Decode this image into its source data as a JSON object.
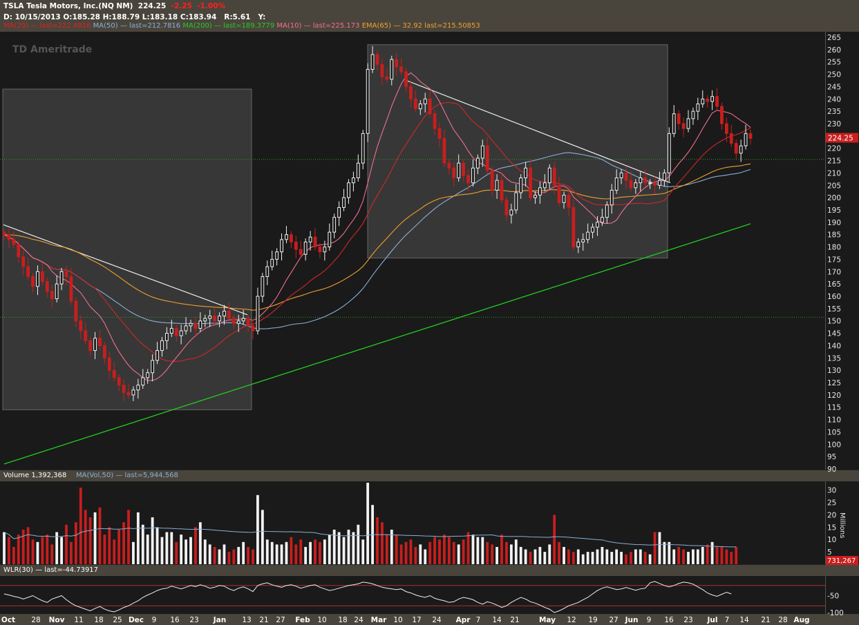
{
  "header": {
    "title": "TSLA Tesla Motors, Inc.(NQ NM)",
    "price": "224.25",
    "change": "-2.25",
    "change_pct": "-1.00%",
    "ohlc": "D: 10/15/2013  O:185.28  H:188.79  L:183.18  C:183.94",
    "r_value": "R:5.61",
    "y_label": "Y:",
    "indicators": [
      {
        "text": "MA(20) — last=222.4816",
        "color": "#e02020"
      },
      {
        "text": "MA(50) — last=212.7816",
        "color": "#8ab0d8"
      },
      {
        "text": "MA(200) — last=189.3779",
        "color": "#22cc22"
      },
      {
        "text": "MA(10) — last=225.173",
        "color": "#f07090"
      },
      {
        "text": "EMA(65) — 32.92 last=215.50853",
        "color": "#f0a030"
      }
    ]
  },
  "logo": "Ameritrade",
  "volume_strip": {
    "label": "Volume 1,392,368",
    "ma_label": "MA(Vol,50) — last=5,944,568"
  },
  "wlr_strip": {
    "label": "WLR(30) — last=-44.73917"
  },
  "price_badge": "224.25",
  "volume_badge": "731,267",
  "volume_axis_title": "Millions",
  "chart_data": [
    {
      "type": "candlestick",
      "title": "TSLA Tesla Motors, Inc.(NQ NM)",
      "ylim": [
        90,
        265
      ],
      "y_ticks": [
        90,
        95,
        100,
        105,
        110,
        115,
        120,
        125,
        130,
        135,
        140,
        145,
        150,
        155,
        160,
        165,
        170,
        175,
        180,
        185,
        190,
        195,
        200,
        205,
        210,
        215,
        220,
        225,
        230,
        235,
        240,
        245,
        250,
        255,
        260,
        265
      ],
      "x_ticks": [
        "Oct",
        "28",
        "Nov",
        "11",
        "18",
        "25",
        "Dec",
        "9",
        "16",
        "23",
        "Jan",
        "13",
        "21",
        "27",
        "Feb",
        "10",
        "18",
        "24",
        "Mar",
        "10",
        "17",
        "24",
        "Apr",
        "7",
        "14",
        "21",
        "May",
        "12",
        "19",
        "27",
        "Jun",
        "9",
        "16",
        "23",
        "Jul",
        "7",
        "14",
        "21",
        "28",
        "Aug"
      ],
      "close_series": [
        185,
        183,
        181,
        176,
        172,
        168,
        164,
        170,
        166,
        162,
        159,
        165,
        170,
        168,
        158,
        150,
        146,
        142,
        138,
        143,
        140,
        135,
        130,
        127,
        124,
        121,
        120,
        122,
        124,
        127,
        129,
        134,
        138,
        142,
        145,
        147,
        144,
        146,
        148,
        149,
        147,
        150,
        151,
        152,
        150,
        152,
        154,
        151,
        149,
        150,
        151,
        148,
        146,
        160,
        168,
        172,
        175,
        178,
        183,
        185,
        182,
        179,
        177,
        182,
        184,
        180,
        178,
        180,
        186,
        192,
        196,
        200,
        206,
        208,
        214,
        226,
        252,
        258,
        254,
        249,
        248,
        256,
        253,
        251,
        245,
        240,
        236,
        238,
        240,
        234,
        228,
        224,
        214,
        212,
        208,
        214,
        209,
        206,
        212,
        216,
        221,
        211,
        203,
        207,
        199,
        193,
        195,
        202,
        208,
        212,
        200,
        201,
        204,
        206,
        212,
        205,
        198,
        201,
        196,
        180,
        182,
        183,
        186,
        188,
        190,
        192,
        197,
        203,
        208,
        210,
        207,
        204,
        206,
        208,
        206,
        206,
        205,
        207,
        210,
        226,
        234,
        230,
        228,
        232,
        235,
        238,
        240,
        239,
        241,
        237,
        230,
        226,
        222,
        218,
        221,
        226,
        224
      ],
      "horizontal_lines": [
        151.5,
        215.5
      ]
    },
    {
      "type": "bar",
      "title": "Volume 1,392,368",
      "ylabel": "Millions",
      "ylim": [
        0,
        33
      ],
      "y_ticks": [
        5,
        10,
        15,
        20,
        25,
        30
      ],
      "values": [
        13,
        11,
        7,
        12,
        14,
        15,
        10,
        9,
        11,
        12,
        8,
        13,
        11,
        16,
        9,
        17,
        31,
        22,
        19,
        21,
        23,
        12,
        15,
        10,
        14,
        17,
        22,
        9,
        21,
        16,
        12,
        19,
        15,
        11,
        13,
        13,
        9,
        12,
        10,
        11,
        15,
        17,
        10,
        8,
        7,
        6,
        8,
        5,
        6,
        7,
        9,
        7,
        6,
        28,
        22,
        10,
        9,
        8,
        8,
        9,
        11,
        8,
        10,
        7,
        9,
        10,
        9,
        10,
        12,
        14,
        13,
        11,
        14,
        13,
        16,
        10,
        33,
        24,
        19,
        17,
        12,
        14,
        12,
        8,
        9,
        10,
        7,
        8,
        6,
        9,
        11,
        10,
        12,
        11,
        9,
        8,
        10,
        13,
        12,
        11,
        11,
        9,
        8,
        7,
        12,
        9,
        8,
        10,
        7,
        6,
        5,
        6,
        7,
        5,
        8,
        20,
        9,
        7,
        6,
        5,
        6,
        4,
        5,
        5,
        6,
        7,
        6,
        5,
        6,
        5,
        4,
        5,
        6,
        6,
        5,
        4,
        13,
        13,
        9,
        9,
        6,
        7,
        6,
        5,
        6,
        6,
        7,
        8,
        9,
        7,
        7,
        6,
        5,
        7
      ],
      "ma_label": "MA(Vol,50) — last=5,944,568"
    },
    {
      "type": "line",
      "title": "WLR(30) — last=-44.73917",
      "ylim": [
        -100,
        0
      ],
      "y_ticks": [
        -50,
        -100
      ],
      "reference_lines": [
        -20,
        -80
      ],
      "values": [
        -45,
        -48,
        -52,
        -55,
        -60,
        -55,
        -50,
        -58,
        -65,
        -70,
        -60,
        -55,
        -50,
        -62,
        -72,
        -80,
        -85,
        -90,
        -95,
        -88,
        -82,
        -90,
        -95,
        -98,
        -92,
        -85,
        -80,
        -72,
        -65,
        -55,
        -48,
        -42,
        -35,
        -30,
        -28,
        -22,
        -26,
        -30,
        -25,
        -20,
        -23,
        -18,
        -22,
        -28,
        -25,
        -20,
        -22,
        -30,
        -35,
        -28,
        -24,
        -30,
        -38,
        -20,
        -15,
        -12,
        -18,
        -22,
        -25,
        -20,
        -18,
        -22,
        -28,
        -24,
        -20,
        -18,
        -25,
        -30,
        -35,
        -32,
        -28,
        -24,
        -20,
        -18,
        -15,
        -10,
        -12,
        -15,
        -20,
        -25,
        -28,
        -30,
        -32,
        -30,
        -38,
        -42,
        -48,
        -52,
        -55,
        -50,
        -58,
        -62,
        -65,
        -70,
        -68,
        -60,
        -55,
        -58,
        -62,
        -70,
        -75,
        -68,
        -72,
        -78,
        -85,
        -80,
        -70,
        -62,
        -55,
        -60,
        -68,
        -72,
        -78,
        -85,
        -90,
        -100,
        -95,
        -88,
        -80,
        -75,
        -70,
        -62,
        -55,
        -45,
        -35,
        -28,
        -24,
        -28,
        -32,
        -30,
        -26,
        -30,
        -34,
        -30,
        -28,
        -12,
        -8,
        -14,
        -20,
        -24,
        -20,
        -14,
        -10,
        -12,
        -16,
        -24,
        -32,
        -42,
        -48,
        -52,
        -46,
        -40,
        -45
      ]
    }
  ]
}
